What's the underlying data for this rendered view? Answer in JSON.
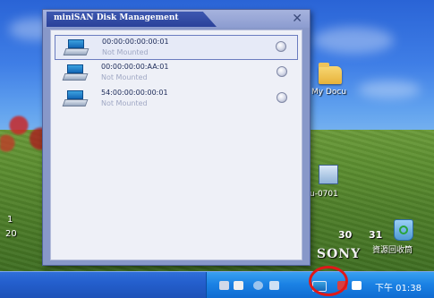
{
  "dialog": {
    "title": "miniSAN Disk Management",
    "close_icon": "close-icon",
    "disks": [
      {
        "id": "00:00:00:00:00:01",
        "status": "Not Mounted",
        "icon": "network-disk-icon",
        "action_icon": "mount-toggle-icon"
      },
      {
        "id": "00:00:00:00:AA:01",
        "status": "Not Mounted",
        "icon": "network-disk-icon",
        "action_icon": "mount-toggle-icon"
      },
      {
        "id": "54:00:00:00:00:01",
        "status": "Not Mounted",
        "icon": "network-disk-icon",
        "action_icon": "mount-toggle-icon"
      }
    ]
  },
  "desktop": {
    "icons": [
      {
        "label": "My Docu",
        "icon": "folder-icon"
      },
      {
        "label": "u-0701",
        "icon": "computer-icon"
      },
      {
        "label": "資源回收筒",
        "icon": "recycle-bin-icon"
      }
    ],
    "calendar_numbers": [
      "30",
      "31"
    ],
    "brand": "SONY",
    "left_fragments": [
      "1",
      "20"
    ]
  },
  "taskbar": {
    "clock": "下午 01:38",
    "highlighted_tray_icon": "minisan-tray-icon"
  },
  "colors": {
    "highlight_ring": "#e01818",
    "taskbar": "#245fcd",
    "dialog_frame": "#8898c9"
  }
}
